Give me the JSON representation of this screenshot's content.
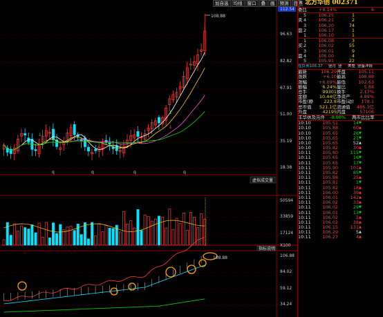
{
  "toolbar": [
    "加自选",
    "均线",
    "窗口",
    "叠",
    "画",
    "预测",
    "目"
  ],
  "price_panel": {
    "y_ticks": [
      "112.54",
      "96.63",
      "82.82",
      "67.91",
      "51.00",
      "35.19",
      "18.38"
    ],
    "peak_label": "108.88",
    "q_marks": [
      "q",
      "q",
      "q",
      "q"
    ]
  },
  "volume_panel": {
    "tag": "虚拟成交量",
    "y_ticks": [
      "50594",
      "33859",
      "17124",
      "X100"
    ]
  },
  "indicator_panel": {
    "tag": "指标说明",
    "y_ticks": [
      "106.88",
      "84.02",
      "59.12",
      "34.24"
    ],
    "peak_label": "108.88"
  },
  "side": {
    "badge": "R",
    "name": "北方华创 002371",
    "weibi": {
      "label": "委比",
      "value": "+8.14%",
      "extra": "6"
    },
    "asks": [
      {
        "lvl": "5",
        "price": "106.25",
        "vol": "1"
      },
      {
        "lvl": "4",
        "price": "106.21",
        "vol": "2"
      },
      {
        "lvl": "3",
        "price": "106.20",
        "vol": "74"
      },
      {
        "lvl": "2",
        "price": "106.17",
        "vol": "1"
      },
      {
        "lvl": "1",
        "price": "106.10",
        "vol": "1"
      }
    ],
    "ask_side_label": [
      "卖",
      "盘"
    ],
    "bids": [
      {
        "lvl": "1",
        "price": "106.08",
        "vol": "3"
      },
      {
        "lvl": "2",
        "price": "106.02",
        "vol": "55"
      },
      {
        "lvl": "3",
        "price": "106.01",
        "vol": "9"
      },
      {
        "lvl": "4",
        "price": "106.00",
        "vol": "4"
      },
      {
        "lvl": "5",
        "price": "105.91",
        "vol": "22"
      }
    ],
    "bid_side_label": [
      "买",
      "盘"
    ],
    "cat_row": [
      "在负责106.37",
      "竖月",
      "竖",
      "美整",
      "竖备冲段"
    ],
    "stats": [
      [
        "最新",
        "106.29",
        "开盘",
        "105.11"
      ],
      [
        "涨跌",
        "+6.10",
        "最高",
        "108.88"
      ],
      [
        "涨幅",
        "+6.09%",
        "最低",
        "102.63"
      ],
      [
        "振幅",
        "6.24%",
        "量比",
        "5.88"
      ],
      [
        "总手",
        "99301",
        "换手",
        "2.17%"
      ],
      [
        "金额",
        "10.44亿",
        "净资产",
        "4.89%"
      ],
      [
        "市盈(静)",
        "223.8",
        "市盈(动)",
        "178.1"
      ],
      [
        "总市值",
        "521.1亿",
        "流通值",
        "486.3亿"
      ],
      [
        "外盘",
        "42195",
        "内盘",
        "57106"
      ]
    ],
    "tick_header": {
      "left": "丰华休及元件",
      "pct": "-0.00%",
      "right": "两市比比率"
    },
    "ticks": [
      {
        "t": "10:10",
        "p": "105.51",
        "v": "14",
        "c": "green"
      },
      {
        "t": "10:10",
        "p": "105.88",
        "v": "60",
        "c": "red"
      },
      {
        "t": "10:10",
        "p": "105.65",
        "v": "26",
        "c": "green"
      },
      {
        "t": "10:10",
        "p": "105.65",
        "v": "21",
        "c": "green"
      },
      {
        "t": "10:10",
        "p": "105.65",
        "v": "52",
        "c": "white"
      },
      {
        "t": "10:10",
        "p": "105.82",
        "v": "30",
        "c": "red"
      },
      {
        "t": "10:11",
        "p": "105.80",
        "v": "115",
        "c": "green"
      },
      {
        "t": "10:11",
        "p": "105.65",
        "v": "16",
        "c": "green"
      },
      {
        "t": "10:11",
        "p": "105.65",
        "v": "17",
        "c": "green"
      },
      {
        "t": "10:11",
        "p": "105.90",
        "v": "101",
        "c": "red"
      },
      {
        "t": "10:11",
        "p": "105.82",
        "v": "85",
        "c": "green"
      },
      {
        "t": "10:11",
        "p": "105.88",
        "v": "25",
        "c": "red"
      },
      {
        "t": "10:11",
        "p": "105.81",
        "v": "1",
        "c": "green"
      },
      {
        "t": "10:11",
        "p": "105.82",
        "v": "18",
        "c": "red"
      },
      {
        "t": "10:11",
        "p": "106.00",
        "v": "39",
        "c": "red"
      },
      {
        "t": "10:11",
        "p": "106.01",
        "v": "142",
        "c": "red"
      },
      {
        "t": "10:11",
        "p": "106.02",
        "v": "33",
        "c": "red"
      },
      {
        "t": "10:11",
        "p": "106.02",
        "v": "29",
        "c": "green"
      },
      {
        "t": "10:11",
        "p": "106.01",
        "v": "13",
        "c": "green"
      },
      {
        "t": "10:11",
        "p": "106.02",
        "v": "5",
        "c": "red"
      },
      {
        "t": "10:11",
        "p": "106.02",
        "v": "38",
        "c": "red"
      },
      {
        "t": "10:11",
        "p": "106.15",
        "v": "131",
        "c": "red"
      },
      {
        "t": "10:11",
        "p": "106.29",
        "v": "5",
        "c": "white"
      },
      {
        "t": "10:11",
        "p": "106.27",
        "v": "4",
        "c": "red"
      }
    ]
  },
  "colors": {
    "up": "#ff3b3b",
    "down": "#00e5ff",
    "axis": "#8b0000",
    "ma1": "#ffffff",
    "ma2": "#ffd400",
    "ma3": "#ff4fd8",
    "ma4": "#00e000",
    "circle": "#ffa500"
  }
}
